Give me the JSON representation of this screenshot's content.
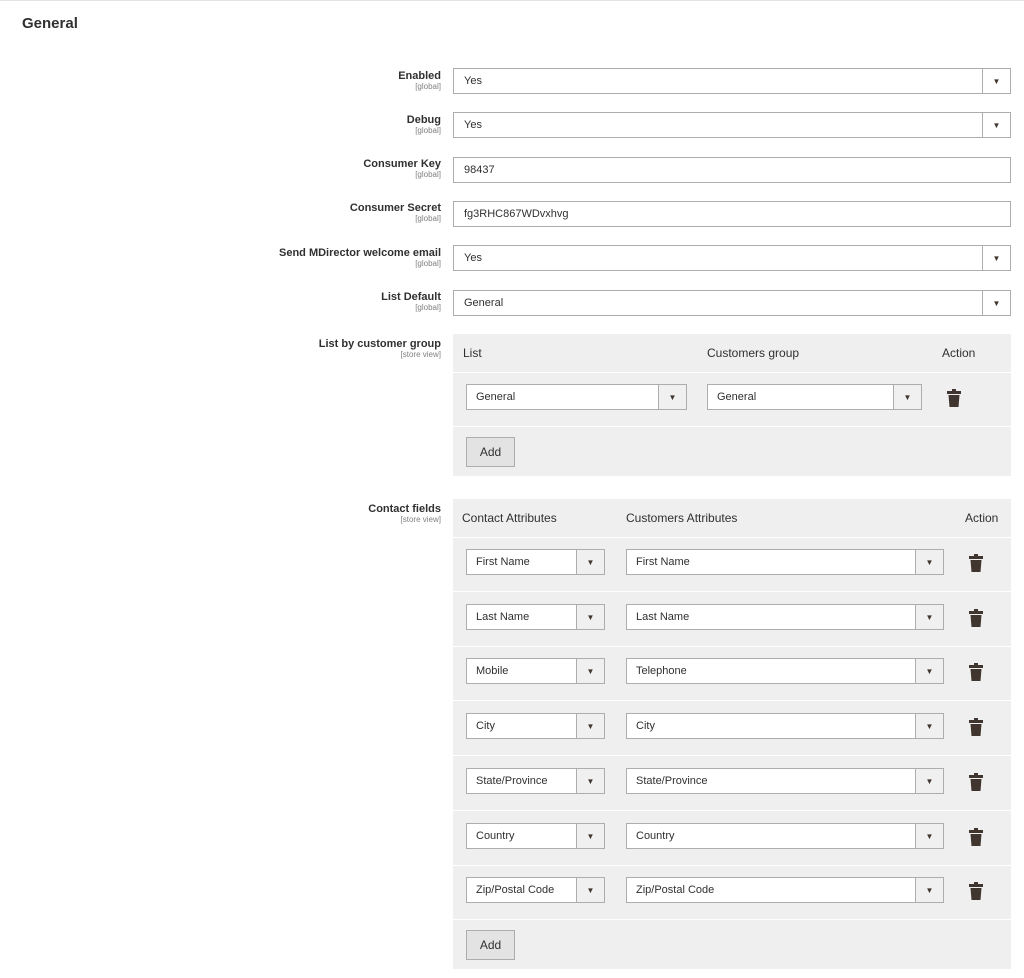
{
  "section": {
    "title": "General"
  },
  "fields": {
    "enabled": {
      "label": "Enabled",
      "scope": "[global]",
      "value": "Yes"
    },
    "debug": {
      "label": "Debug",
      "scope": "[global]",
      "value": "Yes"
    },
    "consumer_key": {
      "label": "Consumer Key",
      "scope": "[global]",
      "value": "98437"
    },
    "consumer_secret": {
      "label": "Consumer Secret",
      "scope": "[global]",
      "value": "fg3RHC867WDvxhvg"
    },
    "welcome_email": {
      "label": "Send MDirector welcome email",
      "scope": "[global]",
      "value": "Yes"
    },
    "list_default": {
      "label": "List Default",
      "scope": "[global]",
      "value": "General"
    }
  },
  "list_by_group": {
    "label": "List by customer group",
    "scope": "[store view]",
    "headers": {
      "list": "List",
      "group": "Customers group",
      "action": "Action"
    },
    "rows": [
      {
        "list": "General",
        "group": "General"
      }
    ],
    "add_label": "Add"
  },
  "contact_fields": {
    "label": "Contact fields",
    "scope": "[store view]",
    "headers": {
      "contact": "Contact Attributes",
      "customer": "Customers Attributes",
      "action": "Action"
    },
    "rows": [
      {
        "contact": "First Name",
        "customer": "First Name"
      },
      {
        "contact": "Last Name",
        "customer": "Last Name"
      },
      {
        "contact": "Mobile",
        "customer": "Telephone"
      },
      {
        "contact": "City",
        "customer": "City"
      },
      {
        "contact": "State/Province",
        "customer": "State/Province"
      },
      {
        "contact": "Country",
        "customer": "Country"
      },
      {
        "contact": "Zip/Postal Code",
        "customer": "Zip/Postal Code"
      }
    ],
    "add_label": "Add"
  },
  "icons": {
    "dropdown": "dropdown-arrow-icon",
    "delete": "trash-icon"
  },
  "colors": {
    "panel_bg": "#efefef",
    "border": "#adadad",
    "icon": "#41362f"
  }
}
